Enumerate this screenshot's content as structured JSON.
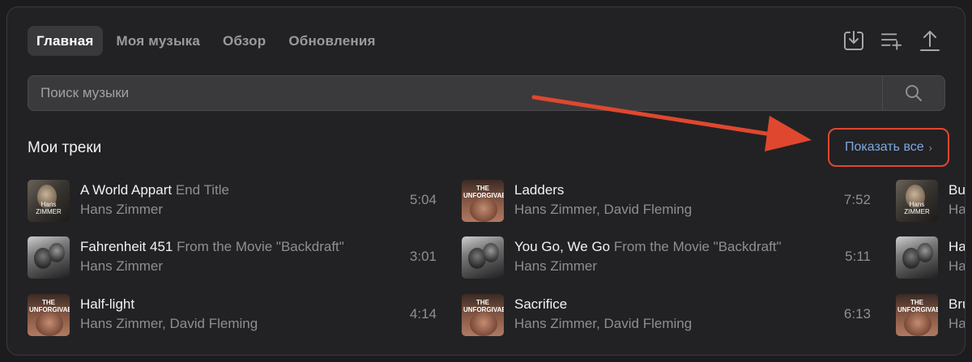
{
  "tabs": [
    {
      "label": "Главная",
      "active": true
    },
    {
      "label": "Моя музыка",
      "active": false
    },
    {
      "label": "Обзор",
      "active": false
    },
    {
      "label": "Обновления",
      "active": false
    }
  ],
  "top_icons": [
    "download-icon",
    "add-to-playlist-icon",
    "upload-icon"
  ],
  "search": {
    "placeholder": "Поиск музыки",
    "value": ""
  },
  "section": {
    "title": "Мои треки",
    "show_all": "Показать все"
  },
  "covers": {
    "hz": "Hans ZIMMER",
    "unf": "THE UNFORGIVABLE"
  },
  "tracks": [
    {
      "title": "A World Appart",
      "subtitle": "End Title",
      "artist": "Hans Zimmer",
      "duration": "5:04",
      "cover": "hz"
    },
    {
      "title": "Fahrenheit 451",
      "subtitle": "From the Movie \"Backdraft\"",
      "artist": "Hans Zimmer",
      "duration": "3:01",
      "cover": "bd"
    },
    {
      "title": "Half-light",
      "subtitle": "",
      "artist": "Hans Zimmer, David Fleming",
      "duration": "4:14",
      "cover": "unf"
    },
    {
      "title": "Ladders",
      "subtitle": "",
      "artist": "Hans Zimmer, David Fleming",
      "duration": "7:52",
      "cover": "unf"
    },
    {
      "title": "You Go, We Go",
      "subtitle": "From the Movie \"Backdraft\"",
      "artist": "Hans Zimmer",
      "duration": "5:11",
      "cover": "bd"
    },
    {
      "title": "Sacrifice",
      "subtitle": "",
      "artist": "Hans Zimmer, David Fleming",
      "duration": "6:13",
      "cover": "unf"
    },
    {
      "title": "Bu",
      "subtitle": "",
      "artist": "Ha",
      "duration": "",
      "cover": "hz"
    },
    {
      "title": "Ha",
      "subtitle": "",
      "artist": "Ha",
      "duration": "",
      "cover": "bd"
    },
    {
      "title": "Bru",
      "subtitle": "",
      "artist": "Ha",
      "duration": "",
      "cover": "unf"
    }
  ],
  "colors": {
    "background": "#222224",
    "accent_link": "#7fa8e0",
    "annotation_red": "#e0472f"
  }
}
